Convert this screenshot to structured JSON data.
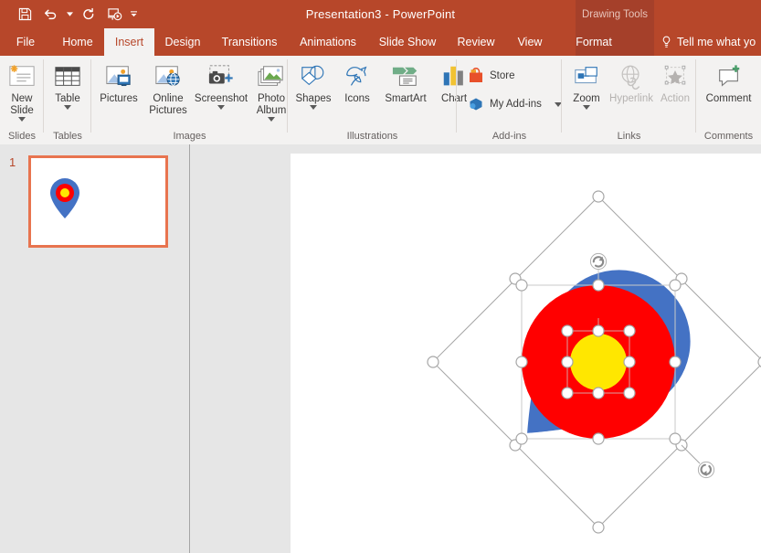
{
  "titlebar": {
    "document_title": "Presentation3  -  PowerPoint",
    "contextual_tools": "Drawing Tools",
    "quick_access": [
      {
        "name": "save",
        "label": "Save"
      },
      {
        "name": "undo",
        "label": "Undo"
      },
      {
        "name": "redo",
        "label": "Redo"
      },
      {
        "name": "start-from-beginning",
        "label": "Start From Beginning"
      },
      {
        "name": "customize-quick-access-toolbar",
        "label": "Customize Quick Access Toolbar"
      }
    ]
  },
  "tabs": [
    {
      "label": "File",
      "active": false
    },
    {
      "label": "Home",
      "active": false
    },
    {
      "label": "Insert",
      "active": true
    },
    {
      "label": "Design",
      "active": false
    },
    {
      "label": "Transitions",
      "active": false
    },
    {
      "label": "Animations",
      "active": false
    },
    {
      "label": "Slide Show",
      "active": false
    },
    {
      "label": "Review",
      "active": false
    },
    {
      "label": "View",
      "active": false
    },
    {
      "label": "Format",
      "active": false
    }
  ],
  "tellme": {
    "label": "Tell me what yo",
    "icon": "lightbulb-icon"
  },
  "ribbon": {
    "groups": [
      {
        "name": "slides",
        "label": "Slides"
      },
      {
        "name": "tables",
        "label": "Tables"
      },
      {
        "name": "images",
        "label": "Images"
      },
      {
        "name": "illustrations",
        "label": "Illustrations"
      },
      {
        "name": "addins",
        "label": "Add-ins"
      },
      {
        "name": "links",
        "label": "Links"
      },
      {
        "name": "comments",
        "label": "Comments"
      }
    ],
    "items": {
      "new_slide": "New\nSlide",
      "table": "Table",
      "pictures": "Pictures",
      "online_pictures": "Online\nPictures",
      "screenshot": "Screenshot",
      "photo_album": "Photo\nAlbum",
      "shapes": "Shapes",
      "icons": "Icons",
      "smartart": "SmartArt",
      "chart": "Chart",
      "store": "Store",
      "my_addins": "My Add-ins",
      "zoom": "Zoom",
      "hyperlink": "Hyperlink",
      "action": "Action",
      "comment": "Comment"
    }
  },
  "thumbnails": {
    "slides": [
      {
        "number": "1",
        "selected": true
      }
    ]
  },
  "slide": {
    "shapes": [
      {
        "name": "map-pin",
        "fill": "#4472c4",
        "rotated": true,
        "selected": true
      },
      {
        "name": "red-circle",
        "fill": "#ff0000",
        "selected": true
      },
      {
        "name": "yellow-circle",
        "fill": "#ffe700",
        "selected": true
      }
    ]
  },
  "colors": {
    "brand": "#b7472a",
    "contextual": "#a5402a",
    "ribbon_bg": "#f3f2f1",
    "pane_bg": "#e6e6e6",
    "selection_border": "#e8744f",
    "blue": "#4472c4",
    "red": "#ff0000",
    "yellow": "#ffe700"
  }
}
